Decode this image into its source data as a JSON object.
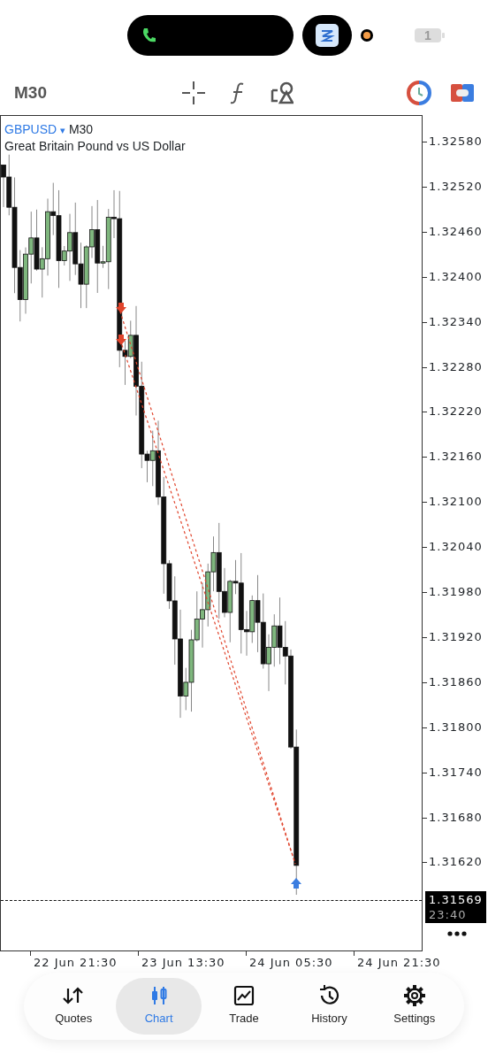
{
  "status_bar": {
    "battery_text": "1"
  },
  "toolbar": {
    "timeframe": "M30"
  },
  "chart": {
    "symbol": "GBPUSD",
    "dropdown_marker": "▾",
    "timeframe": "M30",
    "description": "Great Britain Pound vs US Dollar",
    "price_labels": [
      "1.32580",
      "1.32520",
      "1.32460",
      "1.32400",
      "1.32340",
      "1.32280",
      "1.32220",
      "1.32160",
      "1.32100",
      "1.32040",
      "1.31980",
      "1.31920",
      "1.31860",
      "1.31800",
      "1.31740",
      "1.31680",
      "1.31620"
    ],
    "current_price": "1.31569",
    "countdown": "23:40",
    "time_labels": [
      "22 Jun 21:30",
      "23 Jun 13:30",
      "24 Jun 05:30",
      "24 Jun 21:30"
    ]
  },
  "tab_bar": [
    {
      "kind": "quotes",
      "label": "Quotes",
      "selected": false
    },
    {
      "kind": "chart",
      "label": "Chart",
      "selected": true
    },
    {
      "kind": "trade",
      "label": "Trade",
      "selected": false
    },
    {
      "kind": "history",
      "label": "History",
      "selected": false
    },
    {
      "kind": "settings",
      "label": "Settings",
      "selected": false
    }
  ]
}
